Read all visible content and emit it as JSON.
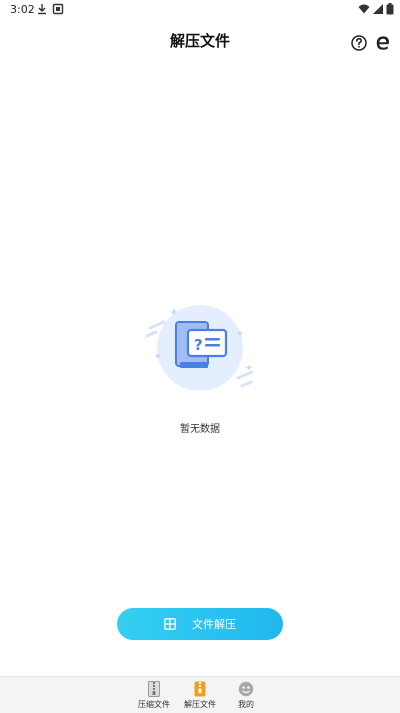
{
  "status_bar": {
    "time": "3:02"
  },
  "header": {
    "title": "解压文件"
  },
  "empty_state": {
    "message": "暂无数据"
  },
  "actions": {
    "extract_label": "文件解压"
  },
  "bottom_nav": {
    "items": [
      {
        "label": "压缩文件",
        "icon": "zip-file-icon"
      },
      {
        "label": "解压文件",
        "icon": "unzip-file-icon",
        "active": true
      },
      {
        "label": "我的",
        "icon": "face-icon"
      }
    ]
  },
  "colors": {
    "accent": "#2ac4f0",
    "active_nav": "#f0a020",
    "illustration_primary": "#4a7fe6",
    "illustration_circle": "#e4eeff"
  }
}
